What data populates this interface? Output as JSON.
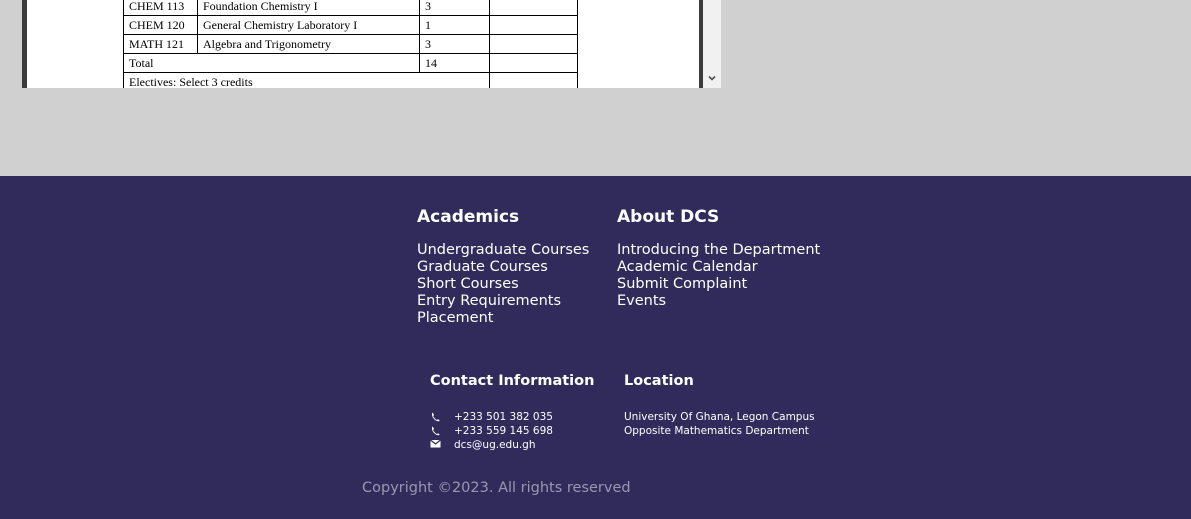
{
  "document": {
    "table": [
      [
        "CHEM 113",
        "Foundation Chemistry I",
        "3",
        ""
      ],
      [
        "CHEM 120",
        "General Chemistry Laboratory I",
        "1",
        ""
      ],
      [
        "MATH 121",
        "Algebra and Trigonometry",
        "3",
        ""
      ]
    ],
    "total_label": "Total",
    "total_value": "14",
    "electives_label": "Electives: Select 3 credits"
  },
  "footer": {
    "academics": {
      "heading": "Academics",
      "links": [
        "Undergraduate Courses",
        "Graduate Courses",
        "Short Courses",
        "Entry Requirements",
        "Placement"
      ]
    },
    "about": {
      "heading": "About DCS",
      "links": [
        "Introducing the Department",
        "Academic Calendar",
        "Submit Complaint",
        "Events"
      ]
    },
    "contact": {
      "heading": "Contact Information",
      "phone1": "+233 501 382 035",
      "phone2": "+233 559 145 698",
      "email": "dcs@ug.edu.gh"
    },
    "location": {
      "heading": "Location",
      "line1": "University Of Ghana, Legon Campus",
      "line2": "Opposite Mathematics Department"
    },
    "copyright": "Copyright ©2023. All rights reserved"
  },
  "icons": {
    "phone": "phone-icon",
    "email": "envelope-icon",
    "scroll_down": "chevron-down-icon"
  },
  "colors": {
    "footer_bg": "#312b5c",
    "page_bg": "#d0d0d0",
    "copyright_text": "#9a97ad"
  }
}
